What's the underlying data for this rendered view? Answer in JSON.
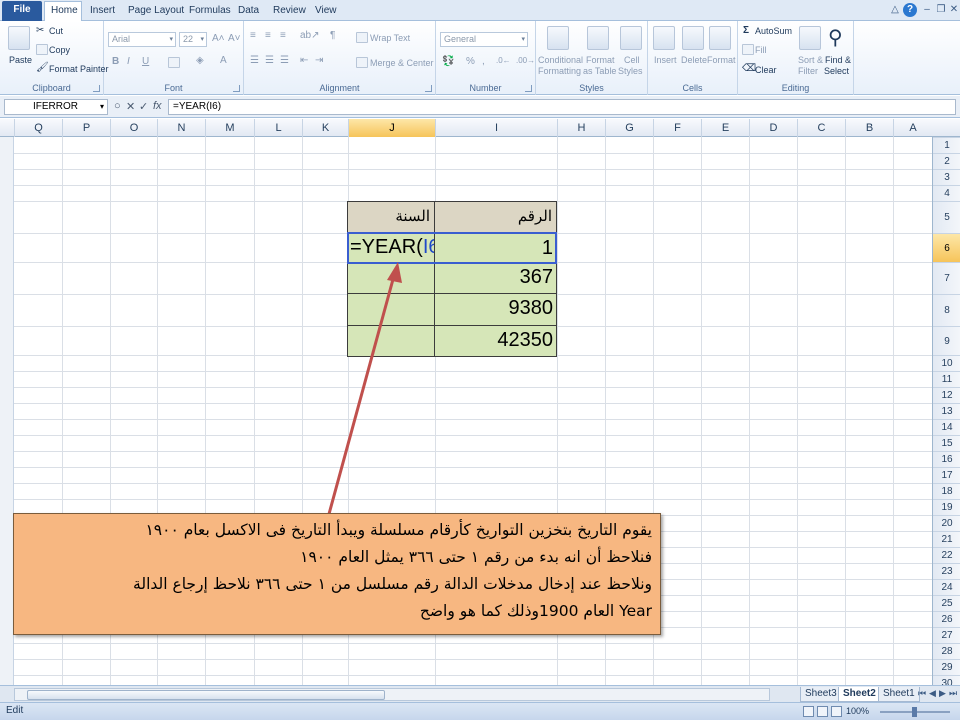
{
  "ribbon": {
    "tabs": [
      "File",
      "Home",
      "Insert",
      "Page Layout",
      "Formulas",
      "Data",
      "Review",
      "View"
    ],
    "clipboard": {
      "title": "Clipboard",
      "paste": "Paste",
      "cut": "Cut",
      "copy": "Copy",
      "format_painter": "Format Painter"
    },
    "font": {
      "title": "Font",
      "name": "Arial",
      "size": "22",
      "bold": "B",
      "italic": "I",
      "underline": "U"
    },
    "alignment": {
      "title": "Alignment",
      "wrap_text": "Wrap Text",
      "merge_center": "Merge & Center"
    },
    "number": {
      "title": "Number",
      "format": "General",
      "percent": "%",
      "comma": ","
    },
    "styles": {
      "title": "Styles",
      "conditional": "Conditional",
      "conditional2": "Formatting",
      "format_table": "Format",
      "format_table2": "as Table",
      "cell_styles": "Cell",
      "cell_styles2": "Styles"
    },
    "cells": {
      "title": "Cells",
      "insert": "Insert",
      "delete": "Delete",
      "format": "Format"
    },
    "editing": {
      "title": "Editing",
      "autosum": "AutoSum",
      "fill": "Fill",
      "clear": "Clear",
      "sort": "Sort &",
      "sort2": "Filter",
      "find": "Find &",
      "find2": "Select"
    }
  },
  "formula_bar": {
    "name_box": "IFERROR",
    "cancel": "✕",
    "enter": "✓",
    "fx": "fx",
    "formula": "=YEAR(I6)"
  },
  "grid": {
    "columns": [
      "Q",
      "P",
      "O",
      "N",
      "M",
      "L",
      "K",
      "J",
      "I",
      "H",
      "G",
      "F",
      "E",
      "D",
      "C",
      "B",
      "A"
    ],
    "active_column": "J",
    "rows": [
      "1",
      "2",
      "3",
      "4",
      "5",
      "6",
      "7",
      "8",
      "9",
      "10",
      "11",
      "12",
      "13",
      "14",
      "15",
      "16",
      "17",
      "18",
      "19",
      "20",
      "21",
      "22",
      "23",
      "24",
      "25",
      "26",
      "27",
      "28",
      "29",
      "30"
    ],
    "active_row": "6"
  },
  "table": {
    "header_year": "السنة",
    "header_number": "الرقم",
    "formula_prefix": "=YEAR(",
    "formula_ref": "I6",
    "formula_suffix": ")",
    "numbers": [
      "1",
      "367",
      "9380",
      "42350"
    ]
  },
  "callout": {
    "line1": "يقوم التاريخ بتخزين التواريخ كأرقام مسلسلة ويبدأ التاريخ فى الاكسل بعام ١٩٠٠",
    "line2": "فنلاحظ  أن انه بدء من رقم ١ حتى ٣٦٦ يمثل العام ١٩٠٠",
    "line3": "ونلاحظ عند إدخال مدخلات الدالة رقم مسلسل من ١ حتى ٣٦٦ نلاحظ إرجاع الدالة",
    "line4": "Year العام 1900وذلك كما هو واضح"
  },
  "sheets": {
    "tabs": [
      "Sheet3",
      "Sheet2",
      "Sheet1"
    ],
    "active": "Sheet2"
  },
  "status": {
    "mode": "Edit",
    "zoom": "100%"
  },
  "colors": {
    "accent": "#2a5a9e",
    "header_fill": "#dcd6c4",
    "body_fill": "#d6e6b8",
    "callout_fill": "#f7b781",
    "arrow": "#c0504d"
  }
}
